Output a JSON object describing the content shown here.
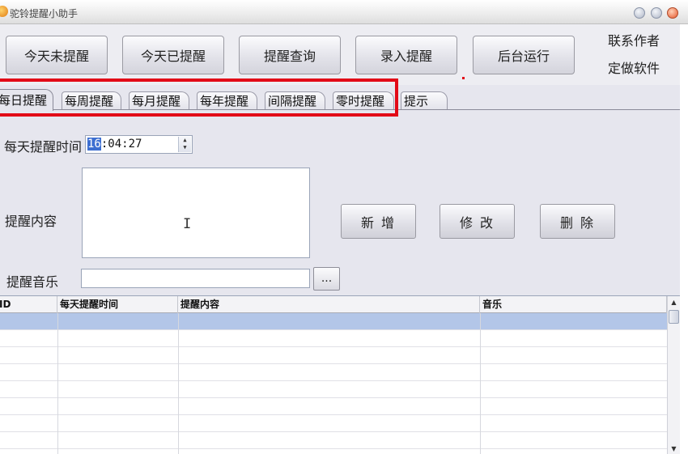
{
  "window": {
    "title": "驼铃提醒小助手"
  },
  "toolbar": {
    "buttons": [
      "今天未提醒",
      "今天已提醒",
      "提醒查询",
      "录入提醒",
      "后台运行"
    ],
    "author_line1": "联系作者",
    "author_line2": "定做软件"
  },
  "tabs": [
    "每日提醒",
    "每周提醒",
    "每月提醒",
    "每年提醒",
    "间隔提醒",
    "零时提醒",
    "提示"
  ],
  "form": {
    "time_label": "每天提醒时间",
    "time_hour": "16",
    "time_rest": ":04:27",
    "content_label": "提醒内容",
    "content_value": "",
    "music_label": "提醒音乐",
    "music_value": "",
    "browse_label": "...",
    "add_label": "新 增",
    "edit_label": "修 改",
    "delete_label": "删 除"
  },
  "grid": {
    "columns": [
      "ID",
      "每天提醒时间",
      "提醒内容",
      "音乐"
    ],
    "rows": [],
    "selected_row": 1
  },
  "colors": {
    "highlight": "#e20a17",
    "selection": "#b3c6e8"
  }
}
